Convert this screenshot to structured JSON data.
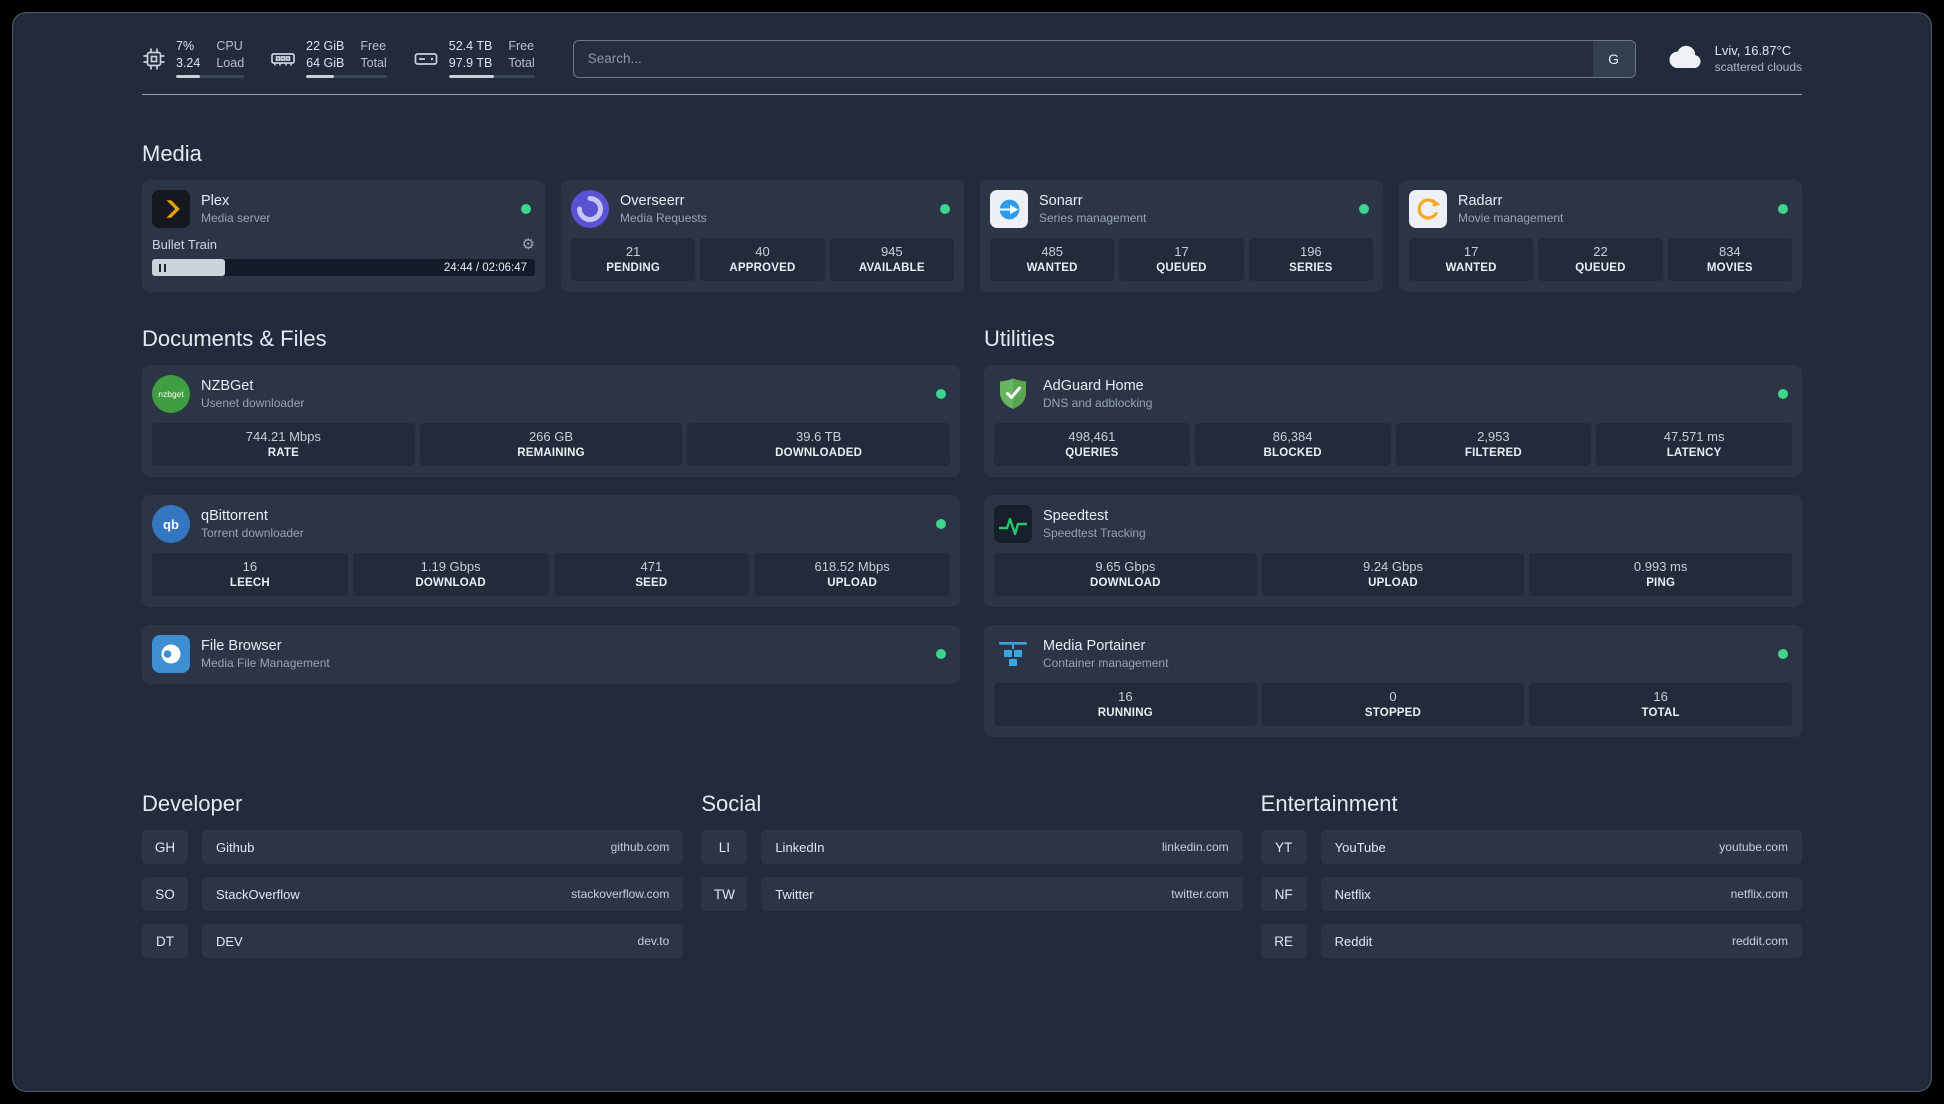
{
  "colors": {
    "background": "#212b3b",
    "card": "#2b3546",
    "tile": "#222b39",
    "status_green": "#3dd68c",
    "plex_amber": "#e5a00d",
    "sonarr_blue": "#2f9ceb",
    "radarr_amber": "#f7a825",
    "nzbget_green": "#3f9e3f",
    "qbittorrent_blue": "#3477c0",
    "adguard_green": "#67b65f",
    "speedtest_green": "#27c46d",
    "portainer_blue": "#3aa7e0",
    "filebrowser_blue": "#3d8fd1"
  },
  "topbar": {
    "cpu": {
      "icon": "cpu-chip-icon",
      "value_top": "7%",
      "value_bottom": "3.24",
      "label_top": "CPU",
      "label_bottom": "Load",
      "bar_width": "35%"
    },
    "memory": {
      "icon": "memory-icon",
      "value_top": "22 GiB",
      "value_bottom": "64 GiB",
      "label_top": "Free",
      "label_bottom": "Total",
      "bar_width": "34%"
    },
    "disk": {
      "icon": "disk-icon",
      "value_top": "52.4 TB",
      "value_bottom": "97.9 TB",
      "label_top": "Free",
      "label_bottom": "Total",
      "bar_width": "53%"
    },
    "search": {
      "placeholder": "Search...",
      "button_label": "G"
    },
    "weather": {
      "icon": "cloud-icon",
      "location": "Lviv, 16.87°C",
      "condition": "scattered clouds"
    }
  },
  "media": {
    "heading": "Media",
    "plex": {
      "icon": "plex-icon",
      "title": "Plex",
      "subtitle": "Media server",
      "now_playing": "Bullet Train",
      "time": "24:44 / 02:06:47",
      "progress_width": "19%"
    },
    "overseerr": {
      "icon": "overseerr-icon",
      "title": "Overseerr",
      "subtitle": "Media Requests",
      "stats": [
        {
          "value": "21",
          "label": "PENDING"
        },
        {
          "value": "40",
          "label": "APPROVED"
        },
        {
          "value": "945",
          "label": "AVAILABLE"
        }
      ]
    },
    "sonarr": {
      "icon": "sonarr-icon",
      "title": "Sonarr",
      "subtitle": "Series management",
      "stats": [
        {
          "value": "485",
          "label": "WANTED"
        },
        {
          "value": "17",
          "label": "QUEUED"
        },
        {
          "value": "196",
          "label": "SERIES"
        }
      ]
    },
    "radarr": {
      "icon": "radarr-icon",
      "title": "Radarr",
      "subtitle": "Movie management",
      "stats": [
        {
          "value": "17",
          "label": "WANTED"
        },
        {
          "value": "22",
          "label": "QUEUED"
        },
        {
          "value": "834",
          "label": "MOVIES"
        }
      ]
    }
  },
  "documents": {
    "heading": "Documents & Files",
    "nzbget": {
      "icon": "nzbget-icon",
      "icon_text": "nzbget",
      "title": "NZBGet",
      "subtitle": "Usenet downloader",
      "stats": [
        {
          "value": "744.21 Mbps",
          "label": "RATE"
        },
        {
          "value": "266 GB",
          "label": "REMAINING"
        },
        {
          "value": "39.6 TB",
          "label": "DOWNLOADED"
        }
      ]
    },
    "qbittorrent": {
      "icon": "qbittorrent-icon",
      "icon_text": "qb",
      "title": "qBittorrent",
      "subtitle": "Torrent downloader",
      "stats": [
        {
          "value": "16",
          "label": "LEECH"
        },
        {
          "value": "1.19 Gbps",
          "label": "DOWNLOAD"
        },
        {
          "value": "471",
          "label": "SEED"
        },
        {
          "value": "618.52 Mbps",
          "label": "UPLOAD"
        }
      ]
    },
    "filebrowser": {
      "icon": "filebrowser-icon",
      "title": "File Browser",
      "subtitle": "Media File Management"
    }
  },
  "utilities": {
    "heading": "Utilities",
    "adguard": {
      "icon": "adguard-icon",
      "title": "AdGuard Home",
      "subtitle": "DNS and adblocking",
      "stats": [
        {
          "value": "498,461",
          "label": "QUERIES"
        },
        {
          "value": "86,384",
          "label": "BLOCKED"
        },
        {
          "value": "2,953",
          "label": "FILTERED"
        },
        {
          "value": "47.571 ms",
          "label": "LATENCY"
        }
      ]
    },
    "speedtest": {
      "icon": "speedtest-icon",
      "title": "Speedtest",
      "subtitle": "Speedtest Tracking",
      "stats": [
        {
          "value": "9.65 Gbps",
          "label": "DOWNLOAD"
        },
        {
          "value": "9.24 Gbps",
          "label": "UPLOAD"
        },
        {
          "value": "0.993 ms",
          "label": "PING"
        }
      ]
    },
    "portainer": {
      "icon": "portainer-icon",
      "title": "Media Portainer",
      "subtitle": "Container management",
      "stats": [
        {
          "value": "16",
          "label": "RUNNING"
        },
        {
          "value": "0",
          "label": "STOPPED"
        },
        {
          "value": "16",
          "label": "TOTAL"
        }
      ]
    }
  },
  "bookmarks": {
    "developer": {
      "heading": "Developer",
      "items": [
        {
          "abbr": "GH",
          "name": "Github",
          "domain": "github.com"
        },
        {
          "abbr": "SO",
          "name": "StackOverflow",
          "domain": "stackoverflow.com"
        },
        {
          "abbr": "DT",
          "name": "DEV",
          "domain": "dev.to"
        }
      ]
    },
    "social": {
      "heading": "Social",
      "items": [
        {
          "abbr": "LI",
          "name": "LinkedIn",
          "domain": "linkedin.com"
        },
        {
          "abbr": "TW",
          "name": "Twitter",
          "domain": "twitter.com"
        }
      ]
    },
    "entertainment": {
      "heading": "Entertainment",
      "items": [
        {
          "abbr": "YT",
          "name": "YouTube",
          "domain": "youtube.com"
        },
        {
          "abbr": "NF",
          "name": "Netflix",
          "domain": "netflix.com"
        },
        {
          "abbr": "RE",
          "name": "Reddit",
          "domain": "reddit.com"
        }
      ]
    }
  }
}
